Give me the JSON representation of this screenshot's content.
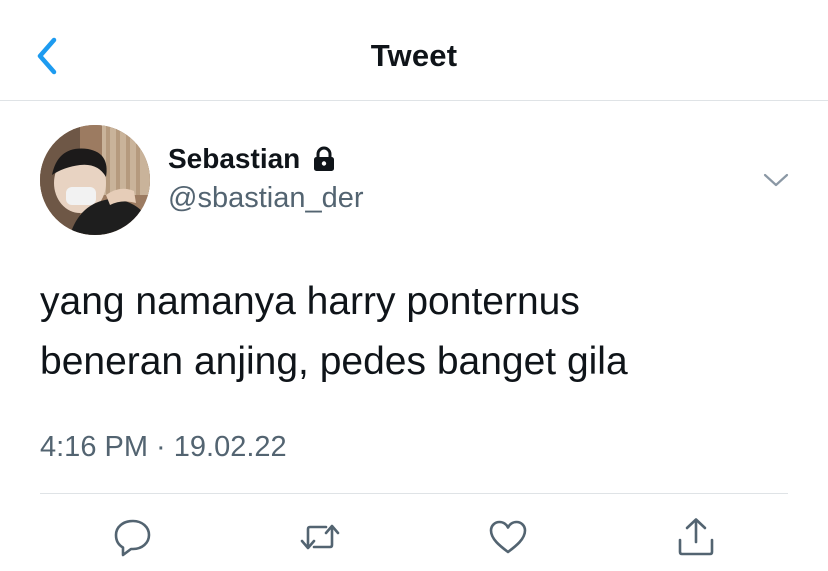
{
  "header": {
    "title": "Tweet"
  },
  "tweet": {
    "display_name": "Sebastian",
    "handle": "@sbastian_der",
    "text_lines": [
      "yang namanya harry ponternus",
      "beneran anjing, pedes banget gila"
    ],
    "timestamp": "4:16 PM · 19.02.22"
  },
  "icons": {
    "back": "chevron-left-icon",
    "lock": "lock-icon",
    "menu": "chevron-down-icon",
    "reply": "reply-icon",
    "retweet": "retweet-icon",
    "like": "heart-icon",
    "share": "share-icon"
  },
  "colors": {
    "accent": "#1d9bf0",
    "text_primary": "#0f1419",
    "text_secondary": "#536471",
    "divider": "#dfe3e6"
  }
}
